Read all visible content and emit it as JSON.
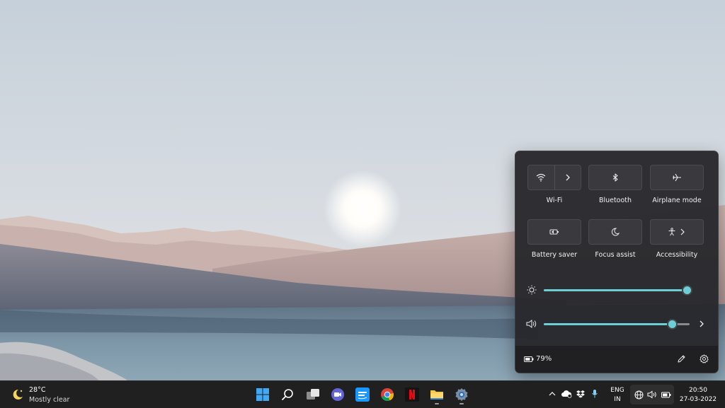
{
  "quick_settings": {
    "tiles": [
      {
        "label": "Wi-Fi",
        "icon": "wifi-icon"
      },
      {
        "label": "Bluetooth",
        "icon": "bluetooth-icon"
      },
      {
        "label": "Airplane mode",
        "icon": "airplane-icon"
      },
      {
        "label": "Battery saver",
        "icon": "battery-saver-icon"
      },
      {
        "label": "Focus assist",
        "icon": "moon-icon"
      },
      {
        "label": "Accessibility",
        "icon": "accessibility-icon"
      }
    ],
    "brightness_level": 0.98,
    "volume_level": 0.88,
    "battery_percent": "79%",
    "accent_color": "#6ccfd6"
  },
  "taskbar": {
    "weather": {
      "temp": "28°C",
      "condition": "Mostly clear"
    },
    "apps": [
      "start",
      "search",
      "task-view",
      "meet",
      "prime-video",
      "chrome",
      "netflix",
      "file-explorer",
      "settings"
    ],
    "language": {
      "line1": "ENG",
      "line2": "IN"
    },
    "clock": {
      "time": "20:50",
      "date": "27-03-2022"
    }
  }
}
